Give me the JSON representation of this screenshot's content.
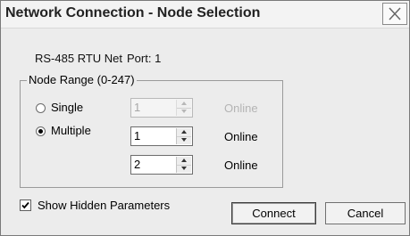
{
  "window": {
    "title": "Network Connection - Node Selection"
  },
  "network": {
    "name": "RS-485 RTU Net",
    "port": "Port: 1"
  },
  "node_range": {
    "legend": "Node Range (0-247)",
    "single": {
      "label": "Single",
      "value": "1",
      "status": "Online",
      "selected": false
    },
    "multiple": {
      "label": "Multiple",
      "selected": true,
      "from_value": "1",
      "from_status": "Online",
      "to_value": "2",
      "to_status": "Online"
    }
  },
  "options": {
    "show_hidden_label": "Show Hidden Parameters",
    "show_hidden_checked": true
  },
  "buttons": {
    "connect": "Connect",
    "cancel": "Cancel"
  },
  "colors": {
    "disabled_text": "#b4b4b4",
    "dialog_bg": "#ececec"
  }
}
